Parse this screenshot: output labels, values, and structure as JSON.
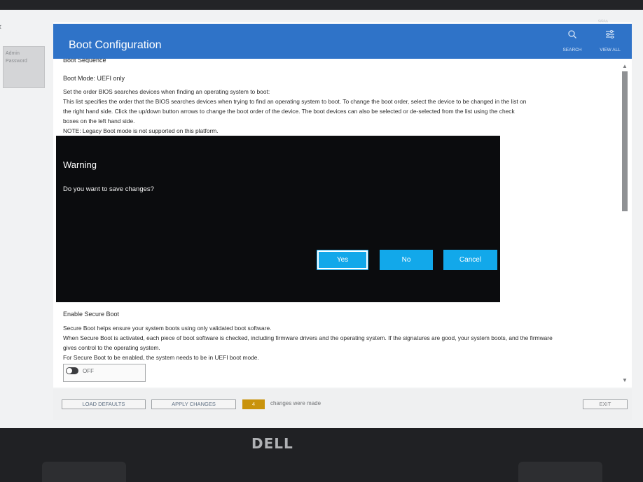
{
  "status": {
    "battery": "99%"
  },
  "left_nav": {
    "label_line1": "Admin",
    "label_line2": "Password"
  },
  "header": {
    "title": "Boot Configuration",
    "search_label": "SEARCH",
    "view_all_label": "VIEW ALL"
  },
  "boot_sequence": {
    "heading": "Boot Sequence",
    "mode": "Boot Mode: UEFI only",
    "desc": [
      "Set the order BIOS searches devices when finding an operating system to boot:",
      "This list specifies the order that the BIOS searches devices when trying to find an operating system to boot.  To change the boot order, select the device to be changed in the list on",
      "the right hand side.  Click the up/down button arrows to change the boot order of the device.  The boot devices can also be selected or de-selected from the list using the check",
      "boxes on the left hand side.",
      "NOTE: Legacy Boot mode is not supported on this platform."
    ]
  },
  "secure_boot": {
    "title": "Enable Secure Boot",
    "desc": [
      "Secure Boot helps ensure your system boots using only validated boot software.",
      "When Secure Boot is activated, each piece of boot software is checked, including firmware drivers and the operating system. If the signatures are good, your system boots, and the firmware",
      "gives control to the operating system.",
      "For Secure Boot to be enabled, the system needs to be in UEFI boot mode."
    ],
    "toggle_label": "OFF"
  },
  "modal": {
    "title": "Warning",
    "message": "Do you want to save changes?",
    "yes_label": "Yes",
    "no_label": "No",
    "cancel_label": "Cancel"
  },
  "footer": {
    "load_defaults": "LOAD DEFAULTS",
    "apply_changes": "APPLY CHANGES",
    "changes_count": "4",
    "changes_text": "changes were made",
    "exit": "EXIT"
  },
  "logo": "DELL"
}
